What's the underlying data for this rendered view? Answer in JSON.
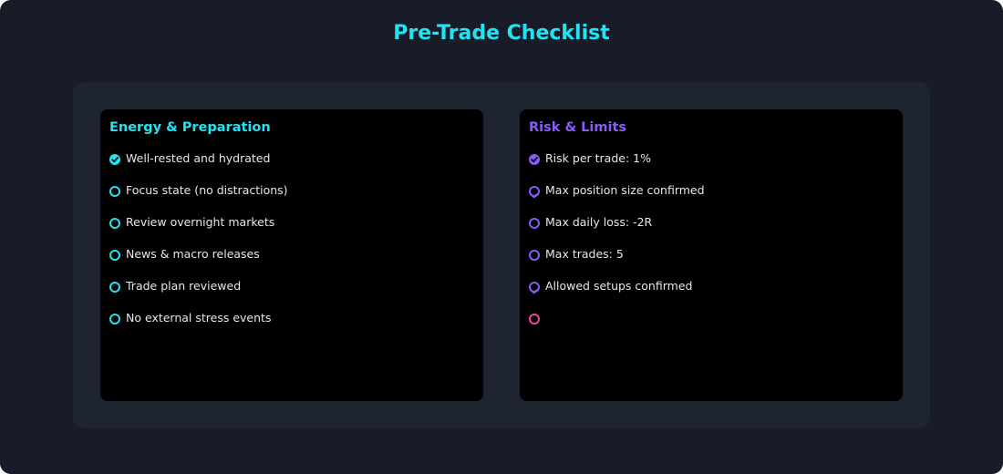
{
  "title": "Pre-Trade Checklist",
  "colors": {
    "window_bg": "#181c28",
    "board_bg": "#1f2431",
    "panel_bg": "#000000",
    "cyan": "#21e4f2",
    "purple": "#8a5cf6",
    "pink": "#ec4899",
    "text": "#e6e6ee"
  },
  "panels": [
    {
      "title": "Energy & Preparation",
      "accent": "#21e4f2",
      "items": [
        {
          "label": "Well-rested and hydrated",
          "checked": true,
          "icon": "check-circle-icon"
        },
        {
          "label": "Focus state (no distractions)",
          "checked": false,
          "icon": "circle-icon"
        },
        {
          "label": "Review overnight markets",
          "checked": false,
          "icon": "circle-icon"
        },
        {
          "label": "News & macro releases",
          "checked": false,
          "icon": "circle-icon"
        },
        {
          "label": "Trade plan reviewed",
          "checked": false,
          "icon": "circle-icon"
        },
        {
          "label": "No external stress events",
          "checked": false,
          "icon": "circle-icon"
        }
      ]
    },
    {
      "title": "Risk & Limits",
      "accent": "#8a5cf6",
      "items": [
        {
          "label": "Risk per trade: 1%",
          "checked": true,
          "icon": "check-circle-icon"
        },
        {
          "label": "Max position size confirmed",
          "checked": false,
          "icon": "circle-tick-icon"
        },
        {
          "label": "Max daily loss: -2R",
          "checked": false,
          "icon": "circle-icon"
        },
        {
          "label": "Max trades: 5",
          "checked": false,
          "icon": "circle-icon"
        },
        {
          "label": "Allowed setups confirmed",
          "checked": false,
          "icon": "circle-tick-icon"
        },
        {
          "label": "",
          "checked": false,
          "icon": "circle-icon",
          "accent": "#ec4899"
        }
      ]
    }
  ]
}
